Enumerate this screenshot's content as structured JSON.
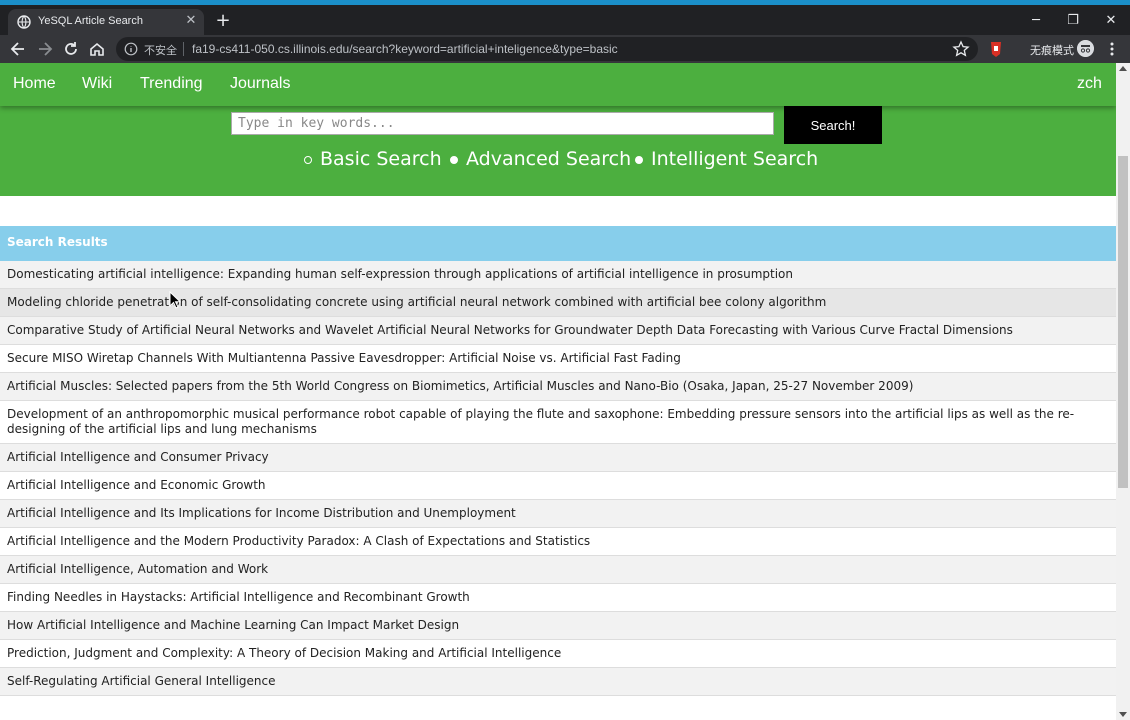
{
  "browser": {
    "tab_title": "YeSQL Article Search",
    "new_tab_icon": "plus-icon",
    "insecure_label": "不安全",
    "url": "fa19-cs411-050.cs.illinois.edu/search?keyword=artificial+inteligence&type=basic",
    "incognito_label": "无痕模式"
  },
  "navbar": {
    "home": "Home",
    "wiki": "Wiki",
    "trending": "Trending",
    "journals": "Journals",
    "user": "zch"
  },
  "search": {
    "placeholder": "Type in key words...",
    "button_label": "Search!",
    "modes": [
      {
        "label": "Basic Search",
        "selected": true
      },
      {
        "label": "Advanced Search",
        "selected": false
      },
      {
        "label": "Intelligent Search",
        "selected": false
      }
    ]
  },
  "results": {
    "header": "Search Results",
    "items": [
      "Domesticating artificial intelligence: Expanding human self-expression through applications of artificial intelligence in prosumption",
      "Modeling chloride penetration of self-consolidating concrete using artificial neural network combined with artificial bee colony algorithm",
      "Comparative Study of Artificial Neural Networks and Wavelet Artificial Neural Networks for Groundwater Depth Data Forecasting with Various Curve Fractal Dimensions",
      "Secure MISO Wiretap Channels With Multiantenna Passive Eavesdropper: Artificial Noise vs. Artificial Fast Fading",
      "Artificial Muscles: Selected papers from the 5th World Congress on Biomimetics, Artificial Muscles and Nano-Bio (Osaka, Japan, 25-27 November 2009)",
      "Development of an anthropomorphic musical performance robot capable of playing the flute and saxophone: Embedding pressure sensors into the artificial lips as well as the re-designing of the artificial lips and lung mechanisms",
      "Artificial Intelligence and Consumer Privacy",
      "Artificial Intelligence and Economic Growth",
      "Artificial Intelligence and Its Implications for Income Distribution and Unemployment",
      "Artificial Intelligence and the Modern Productivity Paradox: A Clash of Expectations and Statistics",
      "Artificial Intelligence, Automation and Work",
      "Finding Needles in Haystacks: Artificial Intelligence and Recombinant Growth",
      "How Artificial Intelligence and Machine Learning Can Impact Market Design",
      "Prediction, Judgment and Complexity: A Theory of Decision Making and Artificial Intelligence",
      "Self-Regulating Artificial General Intelligence"
    ]
  },
  "colors": {
    "nav_green": "#4caf3f",
    "results_header": "#87ceeb",
    "search_button": "#000000"
  }
}
